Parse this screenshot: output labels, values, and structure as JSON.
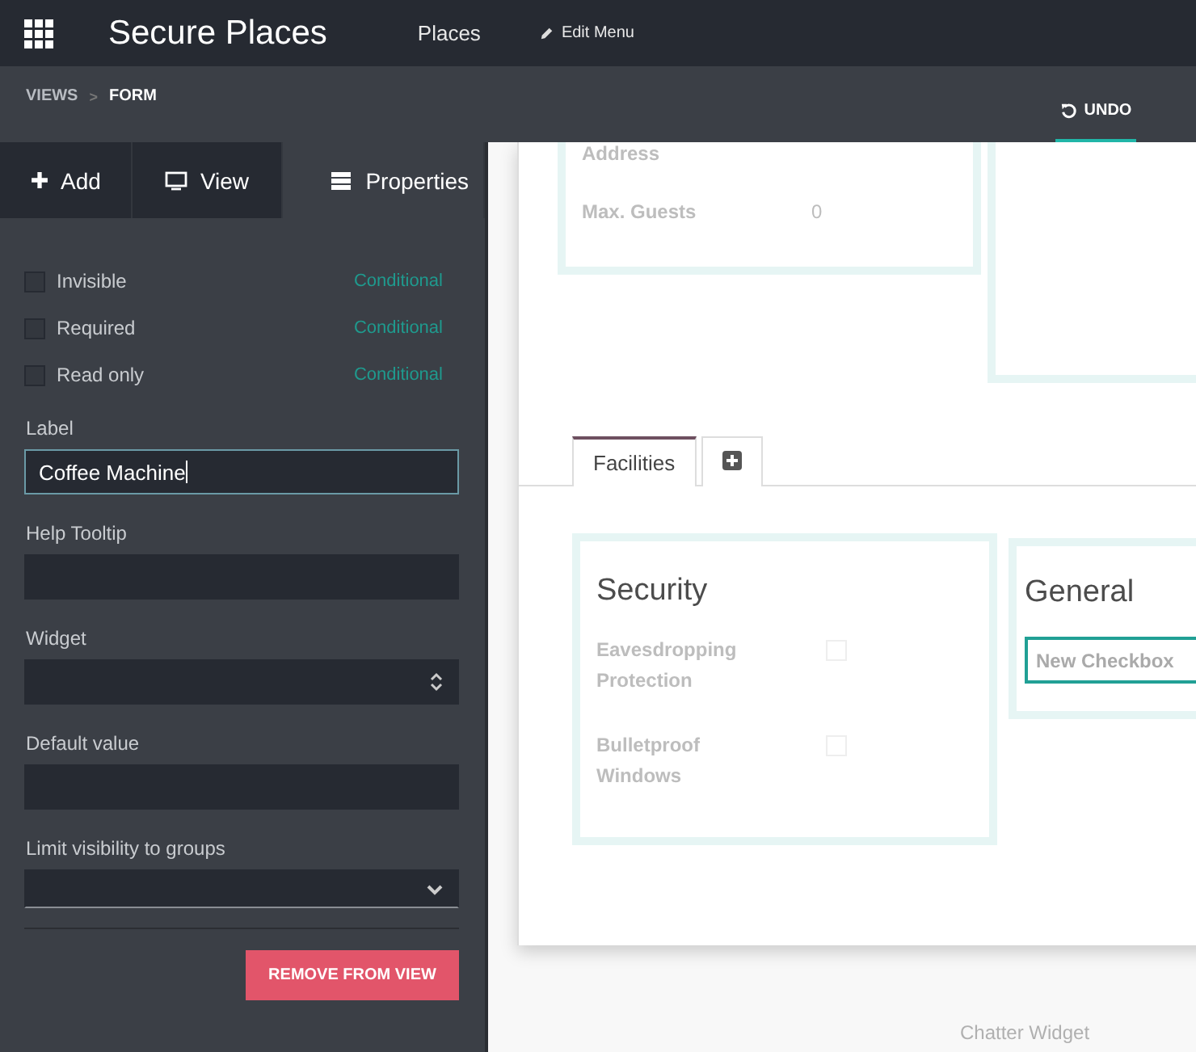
{
  "app_bar": {
    "title": "Secure Places",
    "menu": [
      {
        "label": "Places",
        "kind": "link"
      },
      {
        "label": "Edit Menu",
        "kind": "edit"
      }
    ]
  },
  "breadcrumb": {
    "items": [
      "VIEWS",
      "FORM"
    ],
    "separator": ">"
  },
  "undo": {
    "label": "UNDO",
    "selected": true
  },
  "sidebar": {
    "tabs": [
      {
        "label": "Add",
        "kind": "plus",
        "selected": false
      },
      {
        "label": "View",
        "kind": "monitor",
        "selected": false
      },
      {
        "label": "Properties",
        "kind": "list",
        "selected": true
      }
    ],
    "modifiers": [
      {
        "label": "Invisible",
        "checked": false,
        "link": "Conditional"
      },
      {
        "label": "Required",
        "checked": false,
        "link": "Conditional"
      },
      {
        "label": "Read only",
        "checked": false,
        "link": "Conditional"
      }
    ],
    "fields": [
      {
        "label": "Label",
        "kind": "text",
        "value": "Coffee Machine",
        "focused": true
      },
      {
        "label": "Help Tooltip",
        "kind": "text",
        "focused": false
      },
      {
        "label": "Widget",
        "kind": "select",
        "focused": false
      },
      {
        "label": "Default value",
        "kind": "text",
        "focused": false
      },
      {
        "label": "Limit visibility to groups",
        "kind": "tags",
        "focused": false
      }
    ],
    "remove_button": "REMOVE FROM VIEW"
  },
  "form": {
    "top_fields": [
      {
        "label": "Address"
      },
      {
        "label": "Max. Guests",
        "value": "0"
      }
    ],
    "tabs": [
      {
        "kind": "page",
        "label": "Facilities",
        "selected": true
      },
      {
        "kind": "add",
        "selected": false
      }
    ],
    "groups": [
      {
        "title": "Security",
        "fields": [
          {
            "label": "Eavesdropping Protection",
            "kind": "checkbox",
            "checked": false
          },
          {
            "label": "Bulletproof Windows",
            "kind": "checkbox",
            "checked": false
          }
        ]
      },
      {
        "title": "General",
        "fields": [
          {
            "label": "New Checkbox",
            "kind": "highlighted"
          }
        ]
      }
    ],
    "chatter": "Chatter Widget"
  }
}
